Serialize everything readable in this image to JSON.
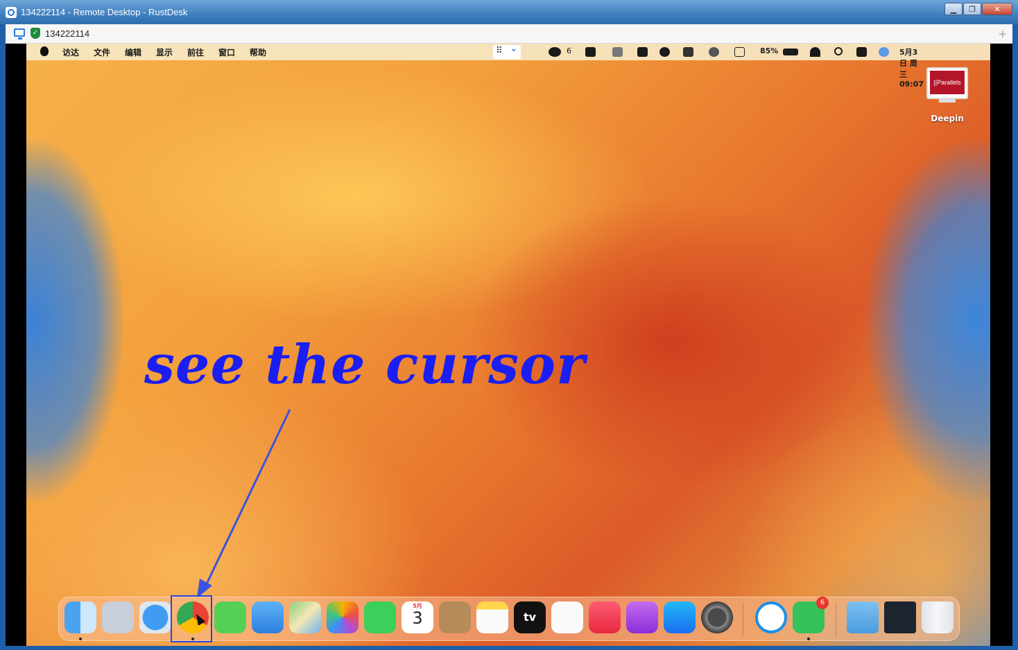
{
  "window": {
    "title": "134222114 - Remote Desktop - RustDesk",
    "controls": {
      "minimize": "▁",
      "maximize": "❐",
      "close": "✕"
    }
  },
  "tab": {
    "label": "134222114",
    "add": "+"
  },
  "menubar": {
    "items": [
      "访达",
      "文件",
      "编辑",
      "显示",
      "前往",
      "窗口",
      "帮助"
    ],
    "wechat_count": "6",
    "battery": "85%",
    "datetime": "5月3日 周三 09:07"
  },
  "desktop": {
    "icon_label": "Deepin",
    "icon_brand": "||Parallels"
  },
  "annotation": {
    "text": "see the cursor"
  },
  "dock": {
    "calendar_month": "5月",
    "calendar_day": "3",
    "wechat_badge": "6",
    "tv_label": "tv"
  },
  "colors": {
    "annotation": "#1a1ef0",
    "focus_box": "#2b46d8",
    "titlebar": "#3f7fbf"
  }
}
